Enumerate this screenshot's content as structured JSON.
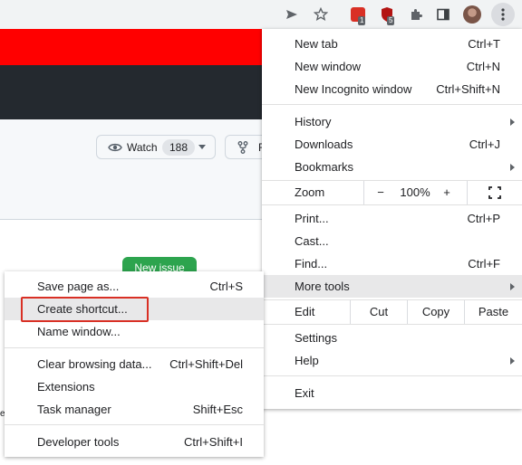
{
  "toolbar": {
    "icons": [
      "send-icon",
      "star-icon",
      "extension-icon-red",
      "extension-icon-shield",
      "puzzle-icon",
      "sidebar-icon",
      "profile-avatar",
      "kebab-menu-icon"
    ],
    "ext1_badge": "1",
    "ext2_badge": "5",
    "colors": {
      "bg": "#f1f3f4",
      "ext1": "#d93025",
      "ext2": "#b31412"
    }
  },
  "page": {
    "watch_label": "Watch",
    "watch_count": "188",
    "fork_label": "F",
    "new_issue_label": "New issue",
    "edge_char": "e",
    "colors": {
      "banner": "#ff0000",
      "header": "#24292f",
      "new_issue": "#2da44e"
    }
  },
  "main_menu": {
    "new_tab": {
      "label": "New tab",
      "shortcut": "Ctrl+T"
    },
    "new_window": {
      "label": "New window",
      "shortcut": "Ctrl+N"
    },
    "new_incognito": {
      "label": "New Incognito window",
      "shortcut": "Ctrl+Shift+N"
    },
    "history": {
      "label": "History"
    },
    "downloads": {
      "label": "Downloads",
      "shortcut": "Ctrl+J"
    },
    "bookmarks": {
      "label": "Bookmarks"
    },
    "zoom": {
      "label": "Zoom",
      "minus": "−",
      "value": "100%",
      "plus": "+"
    },
    "print": {
      "label": "Print...",
      "shortcut": "Ctrl+P"
    },
    "cast": {
      "label": "Cast..."
    },
    "find": {
      "label": "Find...",
      "shortcut": "Ctrl+F"
    },
    "more_tools": {
      "label": "More tools"
    },
    "edit": {
      "label": "Edit",
      "cut": "Cut",
      "copy": "Copy",
      "paste": "Paste"
    },
    "settings": {
      "label": "Settings"
    },
    "help": {
      "label": "Help"
    },
    "exit": {
      "label": "Exit"
    }
  },
  "sub_menu": {
    "save_page": {
      "label": "Save page as...",
      "shortcut": "Ctrl+S"
    },
    "create_shortcut": {
      "label": "Create shortcut..."
    },
    "name_window": {
      "label": "Name window..."
    },
    "clear_browsing": {
      "label": "Clear browsing data...",
      "shortcut": "Ctrl+Shift+Del"
    },
    "extensions": {
      "label": "Extensions"
    },
    "task_manager": {
      "label": "Task manager",
      "shortcut": "Shift+Esc"
    },
    "developer_tools": {
      "label": "Developer tools",
      "shortcut": "Ctrl+Shift+I"
    }
  },
  "highlight_color": "#d93025"
}
